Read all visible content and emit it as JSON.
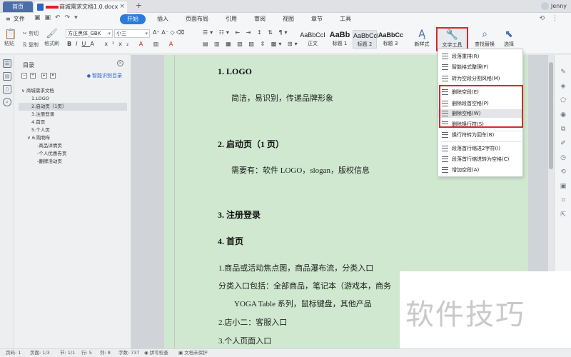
{
  "tabs": {
    "home": "首页",
    "doc_title_suffix": "商城需求文档1.0.docx",
    "add": "+",
    "close": "×"
  },
  "user": {
    "name": "Jenny"
  },
  "menu": {
    "file": "文件",
    "items": [
      {
        "label": "开始",
        "active": true
      },
      {
        "label": "插入"
      },
      {
        "label": "页面布局"
      },
      {
        "label": "引用"
      },
      {
        "label": "审阅"
      },
      {
        "label": "视图"
      },
      {
        "label": "章节"
      },
      {
        "label": "工具"
      }
    ]
  },
  "toolbar": {
    "paste": "粘贴",
    "cut": "剪切",
    "copy": "复制",
    "format_painter": "格式刷",
    "font_family": "方正黑体_GBK",
    "font_size": "小三",
    "styles": [
      {
        "sample": "AaBbCcI",
        "name": "正文"
      },
      {
        "sample": "AaBb",
        "name": "标题 1"
      },
      {
        "sample": "AaBbCcI",
        "name": "标题 2"
      },
      {
        "sample": "AaBbCc",
        "name": "标题 3"
      }
    ],
    "new_style": "新样式",
    "text_tools": "文字工具",
    "find_replace": "查找替换",
    "select": "选择"
  },
  "nav": {
    "title": "目录",
    "smart": "智能识别目录",
    "items": [
      "∨ 商城需求文档",
      "1.LOGO",
      "2.启动页（1页）",
      "3.注册登录",
      "4.首页",
      "5.个人页",
      "∨ 6.购物车",
      "-商品详情页",
      "-个人优惠券页",
      "-翻牌活动页"
    ]
  },
  "document": {
    "h1": "1.  LOGO",
    "p1": "简洁，易识别，传递品牌形象",
    "h2": "2.  启动页（1 页）",
    "p2": "需要有：软件 LOGO，slogan，版权信息",
    "h3": "3.  注册登录",
    "h4": "4.  首页",
    "p4a": "1.商品或活动焦点图，商品瀑布流，分类入口",
    "p4b": "分类入口包括：全部商品，笔记本（游戏本，商务",
    "p4c": "YOGA Table 系列，鼠标键盘，其他产品",
    "p4d": "2.店小二：客服入口",
    "p4e": "3.个人页面入口"
  },
  "dropdown": {
    "items": [
      "段落重排(R)",
      "智能格式整理(F)",
      "转为空段分割风格(M)",
      "删除空段(E)",
      "删除段首空格(P)",
      "删除空格(W)",
      "删除换行符(S)",
      "换行符转为回车(B)",
      "段落首行缩进2字符(I)",
      "段落首行缩进转为空格(C)",
      "增加空段(A)"
    ]
  },
  "status": {
    "page_num": "页码: 1",
    "pages": "页面: 1/3",
    "section": "节: 1/1",
    "row": "行: 5",
    "col": "列: 8",
    "words": "字数: 737",
    "spell": "拼写检查",
    "protect": "文档未保护"
  },
  "watermark": "软件技巧"
}
